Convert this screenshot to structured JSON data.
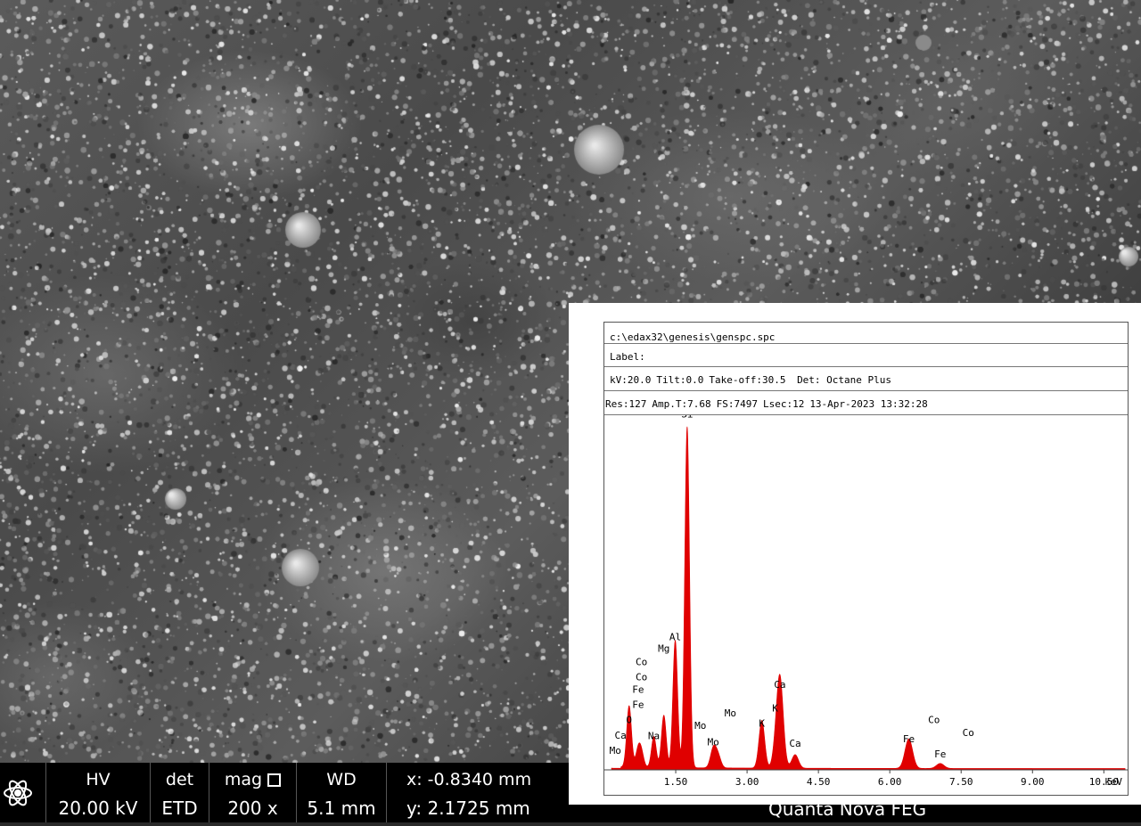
{
  "status_bar": {
    "hv_label": "HV",
    "hv_value": "20.00 kV",
    "det_label": "det",
    "det_value": "ETD",
    "mag_label": "mag",
    "mag_value": "200 x",
    "wd_label": "WD",
    "wd_value": "5.1 mm",
    "x_value": "x: -0.8340 mm",
    "y_value": "y: 2.1725 mm",
    "instrument": "Quanta Nova FEG"
  },
  "eds": {
    "file_path": "c:\\edax32\\genesis\\genspc.spc",
    "label_line": "Label:",
    "kv": "kV:20.0",
    "tilt": "Tilt:0.0",
    "takeoff": "Take-off:30.5",
    "detector": "Det: Octane Plus",
    "res": "Res:127",
    "amp": "Amp.T:7.68",
    "fs": "FS:7497",
    "lsec": "Lsec:12",
    "datetime": "13-Apr-2023  13:32:28"
  },
  "chart_data": {
    "type": "area",
    "color": "#e00000",
    "xlabel": "keV",
    "xlim": [
      0.0,
      11.0
    ],
    "ylim": [
      0,
      7800
    ],
    "x_ticks": [
      1.5,
      3.0,
      4.5,
      6.0,
      7.5,
      9.0,
      10.5
    ],
    "x_tick_labels": [
      "1.50",
      "3.00",
      "4.50",
      "6.00",
      "7.50",
      "9.00",
      "10.50"
    ],
    "peaks": [
      {
        "kev": 0.52,
        "height": 1350,
        "width": 0.05
      },
      {
        "kev": 0.71,
        "height": 380,
        "width": 0.05
      },
      {
        "kev": 0.78,
        "height": 300,
        "width": 0.05
      },
      {
        "kev": 1.04,
        "height": 680,
        "width": 0.05
      },
      {
        "kev": 1.25,
        "height": 1150,
        "width": 0.05
      },
      {
        "kev": 1.49,
        "height": 2800,
        "width": 0.05
      },
      {
        "kev": 1.74,
        "height": 7500,
        "width": 0.05
      },
      {
        "kev": 2.29,
        "height": 420,
        "width": 0.06
      },
      {
        "kev": 2.39,
        "height": 260,
        "width": 0.06
      },
      {
        "kev": 3.31,
        "height": 1050,
        "width": 0.06
      },
      {
        "kev": 3.59,
        "height": 250,
        "width": 0.06
      },
      {
        "kev": 3.69,
        "height": 2000,
        "width": 0.07
      },
      {
        "kev": 4.01,
        "height": 300,
        "width": 0.07
      },
      {
        "kev": 6.4,
        "height": 650,
        "width": 0.08
      },
      {
        "kev": 7.06,
        "height": 110,
        "width": 0.08
      }
    ],
    "labels": [
      {
        "text": "Si",
        "kev": 1.74,
        "count": 7750
      },
      {
        "text": "Al",
        "kev": 1.49,
        "count": 2850
      },
      {
        "text": "Mg",
        "kev": 1.25,
        "count": 2600
      },
      {
        "text": "Co",
        "kev": 0.78,
        "count": 2300
      },
      {
        "text": "Co",
        "kev": 0.78,
        "count": 1970
      },
      {
        "text": "Fe",
        "kev": 0.71,
        "count": 1700
      },
      {
        "text": "Fe",
        "kev": 0.71,
        "count": 1360
      },
      {
        "text": "O",
        "kev": 0.52,
        "count": 1030
      },
      {
        "text": "Ca",
        "kev": 0.34,
        "count": 690
      },
      {
        "text": "Mo",
        "kev": 0.23,
        "count": 350
      },
      {
        "text": "Na",
        "kev": 1.04,
        "count": 680
      },
      {
        "text": "Mo",
        "kev": 2.02,
        "count": 900
      },
      {
        "text": "Mo",
        "kev": 2.29,
        "count": 540
      },
      {
        "text": "Mo",
        "kev": 2.65,
        "count": 1180
      },
      {
        "text": "K",
        "kev": 3.31,
        "count": 950
      },
      {
        "text": "K",
        "kev": 3.59,
        "count": 1280
      },
      {
        "text": "Ca",
        "kev": 3.69,
        "count": 1800
      },
      {
        "text": "Ca",
        "kev": 4.01,
        "count": 510
      },
      {
        "text": "Fe",
        "kev": 6.4,
        "count": 610
      },
      {
        "text": "Fe",
        "kev": 7.06,
        "count": 270
      },
      {
        "text": "Co",
        "kev": 6.93,
        "count": 1030
      },
      {
        "text": "Co",
        "kev": 7.65,
        "count": 740
      }
    ]
  }
}
